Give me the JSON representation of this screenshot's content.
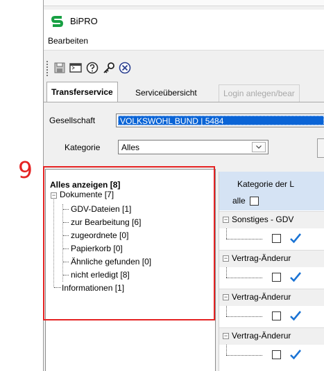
{
  "step_number": "9",
  "app": {
    "title": "BiPRO",
    "logo_color": "#18a043"
  },
  "menu": {
    "items": [
      "Bearbeiten"
    ]
  },
  "toolbar": {
    "icons": [
      "save-icon",
      "window-icon",
      "help-icon",
      "key-icon",
      "close-icon"
    ]
  },
  "tabs": [
    {
      "label": "Transferservice",
      "active": true
    },
    {
      "label": "Serviceübersicht",
      "active": false
    },
    {
      "label": "Login anlegen/bear",
      "active": false,
      "disabled": true
    }
  ],
  "filters": {
    "gesellschaft_label": "Gesellschaft",
    "gesellschaft_value": "VOLKSWOHL BUND | 5484",
    "kategorie_label": "Kategorie",
    "kategorie_value": "Alles"
  },
  "tree": {
    "root": "Alles anzeigen [8]",
    "dokumente": "Dokumente [7]",
    "children": [
      "GDV-Dateien [1]",
      "zur Bearbeitung [6]",
      "zugeordnete [0]",
      "Papierkorb [0]",
      "Ähnliche gefunden [0]",
      "nicht erledigt [8]"
    ],
    "informationen": "Informationen [1]"
  },
  "grid": {
    "header": "Kategorie der L",
    "alle_label": "alle",
    "groups": [
      "Sonstiges - GDV",
      "Vertrag-Änderur",
      "Vertrag-Änderur",
      "Vertrag-Änderur"
    ]
  },
  "colors": {
    "highlight": "#e52222",
    "selection": "#0a64d6",
    "grid_header": "#d5e3f4",
    "check": "#1a73d4"
  }
}
